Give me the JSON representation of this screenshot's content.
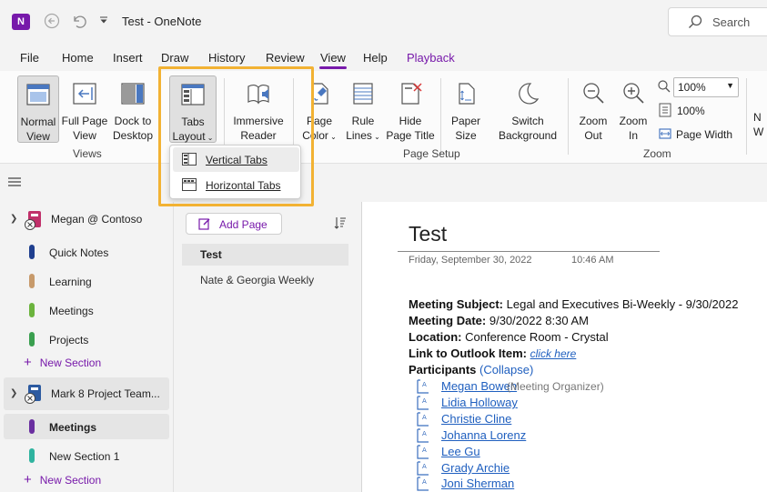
{
  "titlebar": {
    "app_logo": "N",
    "title": "Test  -  OneNote",
    "back_icon": "back-arrow-icon",
    "undo_icon": "undo-icon",
    "qat_icon": "customize-qat-icon",
    "search_label": "Search"
  },
  "tabs": [
    "File",
    "Home",
    "Insert",
    "Draw",
    "History",
    "Review",
    "View",
    "Help",
    "Playback"
  ],
  "active_tab": "View",
  "ribbon": {
    "views": {
      "normal_view": [
        "Normal",
        "View"
      ],
      "full_page_view": [
        "Full Page",
        "View"
      ],
      "dock_to_desktop": [
        "Dock to",
        "Desktop"
      ],
      "group_label": "Views"
    },
    "tabs_layout": [
      "Tabs",
      "Layout"
    ],
    "immersive_reader": [
      "Immersive",
      "Reader"
    ],
    "page_setup": {
      "page_color": [
        "Page",
        "Color"
      ],
      "rule_lines": [
        "Rule",
        "Lines"
      ],
      "hide_page_title": [
        "Hide",
        "Page Title"
      ],
      "paper_size": [
        "Paper",
        "Size"
      ],
      "group_label": "Page Setup"
    },
    "switch_background": [
      "Switch",
      "Background"
    ],
    "zoom": {
      "zoom_out": [
        "Zoom",
        "Out"
      ],
      "zoom_in": [
        "Zoom",
        "In"
      ],
      "zoom_value": "100%",
      "hundred_percent": "100%",
      "page_width": "Page Width",
      "group_label": "Zoom"
    },
    "cut_off": [
      "N",
      "W"
    ]
  },
  "tabs_layout_menu": {
    "vertical": "Vertical Tabs",
    "horizontal": "Horizontal Tabs"
  },
  "navigation": {
    "notebooks": [
      {
        "name": "Megan @ Contoso",
        "color": "#c0306a",
        "sections": [
          {
            "name": "Quick Notes",
            "color": "#1f3f8f"
          },
          {
            "name": "Learning",
            "color": "#c79a6b"
          },
          {
            "name": "Meetings",
            "color": "#6bb33d"
          },
          {
            "name": "Projects",
            "color": "#3a9f4f"
          }
        ],
        "new_section": "New Section"
      },
      {
        "name": "Mark 8 Project Team...",
        "color": "#2c5aa0",
        "sections": [
          {
            "name": "Meetings",
            "color": "#6a2fa0"
          },
          {
            "name": "New Section 1",
            "color": "#2fb39f"
          }
        ],
        "new_section": "New Section"
      }
    ]
  },
  "pages": {
    "add_page": "Add Page",
    "items": [
      "Test",
      "Nate & Georgia Weekly"
    ]
  },
  "canvas": {
    "title": "Test",
    "date": "Friday, September 30, 2022",
    "time": "10:46 AM",
    "meeting_subject_label": "Meeting Subject:",
    "meeting_subject": " Legal and Executives Bi-Weekly - 9/30/2022",
    "meeting_date_label": "Meeting Date:",
    "meeting_date": " 9/30/2022 8:30 AM",
    "location_label": "Location:",
    "location": " Conference Room - Crystal",
    "outlook_label": "Link to Outlook Item:",
    "outlook_link": "click here",
    "participants_label": "Participants",
    "collapse": "(Collapse)",
    "participants": [
      {
        "name": "Megan Bowen",
        "role": "(Meeting Organizer)"
      },
      {
        "name": "Lidia Holloway"
      },
      {
        "name": "Christie Cline"
      },
      {
        "name": "Johanna Lorenz"
      },
      {
        "name": "Lee Gu"
      },
      {
        "name": "Grady Archie"
      },
      {
        "name": "Joni Sherman"
      }
    ]
  },
  "colors": {
    "accent": "#7719aa",
    "highlight": "#f2b233",
    "link": "#1f5fbf"
  }
}
